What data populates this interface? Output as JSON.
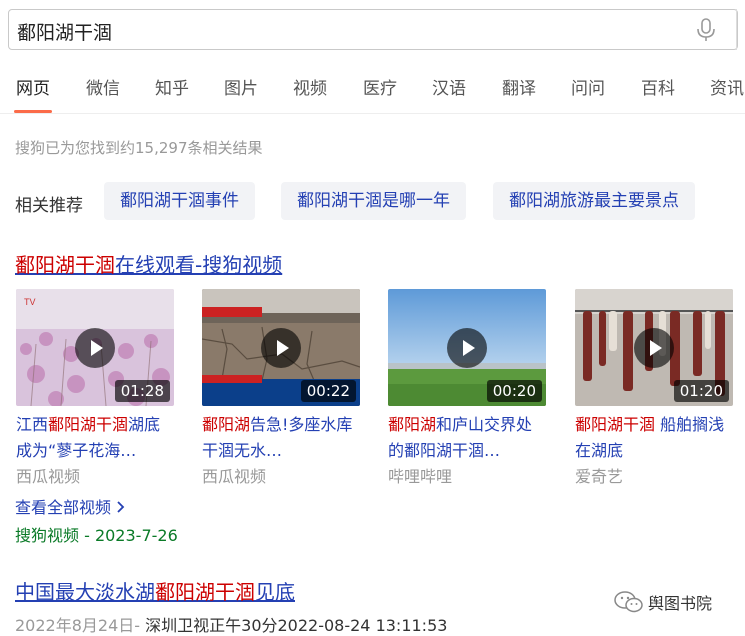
{
  "search": {
    "query": "鄱阳湖干涸"
  },
  "tabs": [
    "网页",
    "微信",
    "知乎",
    "图片",
    "视频",
    "医疗",
    "汉语",
    "翻译",
    "问问",
    "百科",
    "资讯"
  ],
  "result_count": "搜狗已为您找到约15,297条相关结果",
  "related": {
    "label": "相关推荐",
    "items": [
      "鄱阳湖干涸事件",
      "鄱阳湖干涸是哪一年",
      "鄱阳湖旅游最主要景点"
    ]
  },
  "video_block": {
    "title_highlight": "鄱阳湖干涸",
    "title_rest": "在线观看-搜狗视频",
    "videos": [
      {
        "duration": "01:28",
        "title_pre": "江西",
        "title_hl": "鄱阳湖干涸",
        "title_post": "湖底成为“蓼子花海…",
        "source": "西瓜视频"
      },
      {
        "duration": "00:22",
        "title_pre": "",
        "title_hl": "鄱阳湖",
        "title_post": "告急!多座水库干涸无水…",
        "source": "西瓜视频"
      },
      {
        "duration": "00:20",
        "title_pre": "",
        "title_hl": "鄱阳湖",
        "title_post": "和庐山交界处的鄱阳湖干涸…",
        "source": "哔哩哔哩"
      },
      {
        "duration": "01:20",
        "title_pre": "",
        "title_hl": "鄱阳湖干涸",
        "title_post": " 船舶搁浅在湖底",
        "source": "爱奇艺"
      }
    ],
    "see_all": "查看全部视频",
    "source_line": "搜狗视频 - 2023-7-26"
  },
  "result2": {
    "title_pre": "中国最大淡水湖",
    "title_hl": "鄱阳湖干涸",
    "title_post": "见底",
    "date": "2022年8月24日-",
    "meta": " 深圳卫视正午30分2022-08-24 13:11:53"
  },
  "watermark": "舆图书院"
}
